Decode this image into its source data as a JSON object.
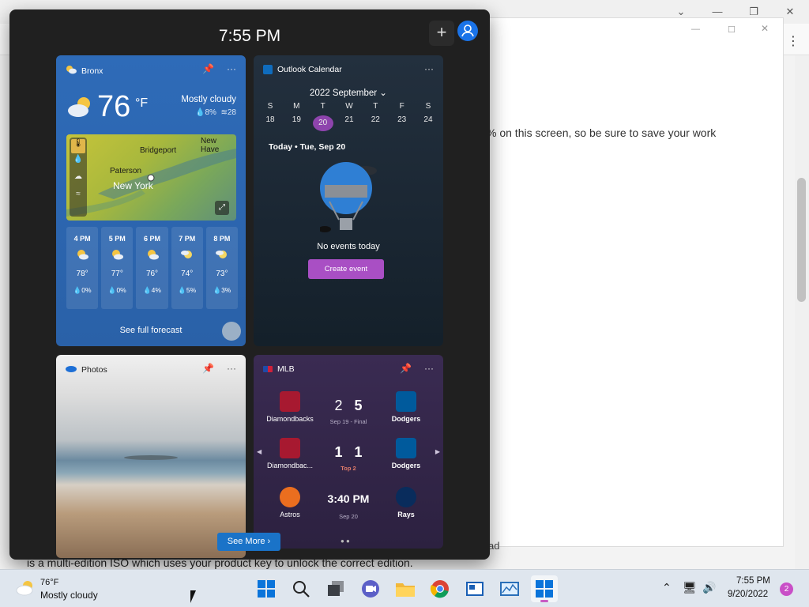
{
  "background": {
    "notice_text": "% on this screen, so be sure to save your work",
    "body_text": "is a multi-edition ISO which uses your product key to unlock the correct edition.",
    "fragment_text": "ad"
  },
  "board": {
    "time": "7:55 PM",
    "add_label": "+"
  },
  "weather": {
    "location": "Bronx",
    "temp": "76",
    "unit": "°F",
    "condition": "Mostly cloudy",
    "precip": "8%",
    "humidity": "28",
    "map_labels": [
      "Bridgeport",
      "New Have",
      "Paterson",
      "New York"
    ],
    "hourly": [
      {
        "time": "4 PM",
        "temp": "78°",
        "precip": "0%"
      },
      {
        "time": "5 PM",
        "temp": "77°",
        "precip": "0%"
      },
      {
        "time": "6 PM",
        "temp": "76°",
        "precip": "4%"
      },
      {
        "time": "7 PM",
        "temp": "74°",
        "precip": "5%"
      },
      {
        "time": "8 PM",
        "temp": "73°",
        "precip": "3%"
      }
    ],
    "forecast_link": "See full forecast"
  },
  "calendar": {
    "title": "Outlook Calendar",
    "month": "2022 September",
    "weekdays": [
      "S",
      "M",
      "T",
      "W",
      "T",
      "F",
      "S"
    ],
    "dates": [
      "18",
      "19",
      "20",
      "21",
      "22",
      "23",
      "24"
    ],
    "today_label": "Today • Tue, Sep 20",
    "empty_text": "No events today",
    "create_button": "Create event"
  },
  "photos": {
    "title": "Photos"
  },
  "mlb": {
    "title": "MLB",
    "games": [
      {
        "away": "Diamondbacks",
        "home": "Dodgers",
        "away_score": "2",
        "home_score": "5",
        "status": "Sep 19 - Final"
      },
      {
        "away": "Diamondbac...",
        "home": "Dodgers",
        "away_score": "1",
        "home_score": "1",
        "status": "Top 2"
      },
      {
        "away": "Astros",
        "home": "Rays",
        "time": "3:40 PM",
        "status": "Sep 20"
      }
    ],
    "see_more": "See More"
  },
  "taskbar": {
    "weather_temp": "76°F",
    "weather_cond": "Mostly cloudy",
    "clock_time": "7:55 PM",
    "clock_date": "9/20/2022",
    "notification_count": "2"
  },
  "colors": {
    "board_bg": "#202020",
    "weather_bg": "#2e6bb8",
    "calendar_accent": "#8e44ad",
    "create_btn": "#a94fc4",
    "mlb_bg": "#3a2b52",
    "see_more_bg": "#1a73c8",
    "taskbar_bg": "#dfe6ee"
  }
}
